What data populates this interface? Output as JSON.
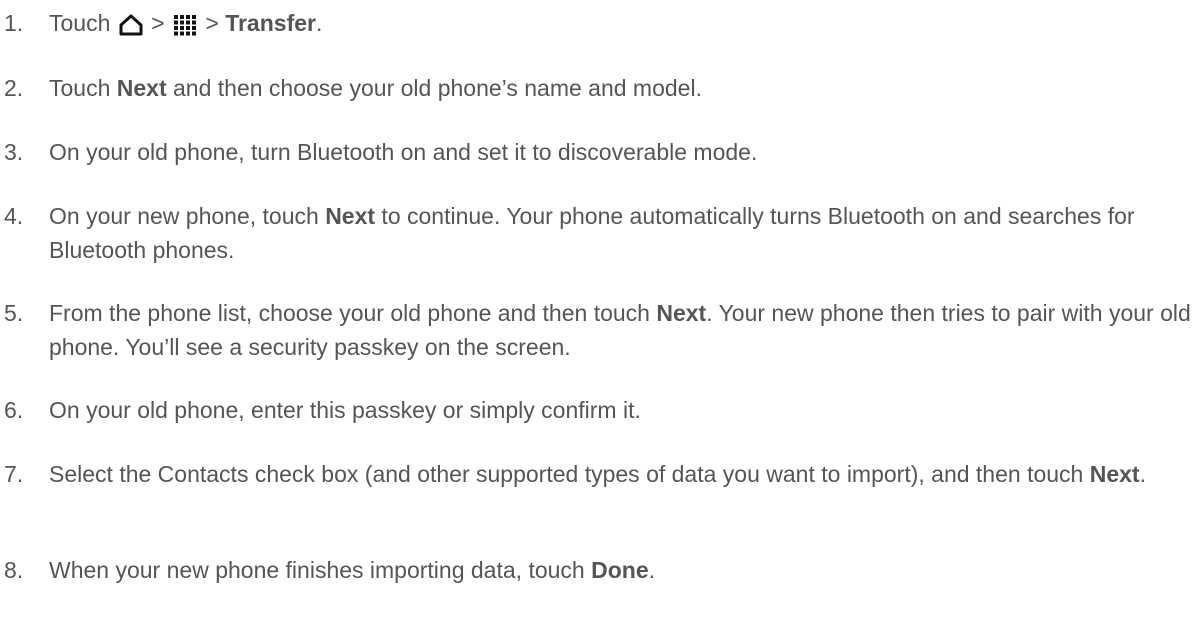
{
  "steps": [
    {
      "num": "1.",
      "pre": "Touch",
      "sep1": ">",
      "sep2": ">",
      "bold": "Transfer",
      "post": ".",
      "icons": [
        "home-icon",
        "apps-grid-icon"
      ]
    },
    {
      "num": "2.",
      "pre": "Touch ",
      "bold": "Next",
      "post": " and then choose your old phone’s name and model."
    },
    {
      "num": "3.",
      "text": "On your old phone, turn Bluetooth on and set it to discoverable mode."
    },
    {
      "num": "4.",
      "pre": "On your new phone, touch ",
      "bold": "Next",
      "post": " to continue. Your phone automatically turns Bluetooth on and searches for Bluetooth phones."
    },
    {
      "num": "5.",
      "pre": "From the phone list, choose your old phone and then touch ",
      "bold": "Next",
      "post": ". Your new phone then tries to pair with your old phone. You’ll see a security passkey on the screen."
    },
    {
      "num": "6.",
      "text": "On your old phone, enter this passkey or simply confirm it."
    },
    {
      "num": "7.",
      "pre": "Select the Contacts check box (and other supported types of data you want to import), and then touch ",
      "bold": "Next",
      "post": "."
    },
    {
      "num": "8.",
      "pre": "When your new phone finishes importing data, touch ",
      "bold": "Done",
      "post": "."
    }
  ]
}
